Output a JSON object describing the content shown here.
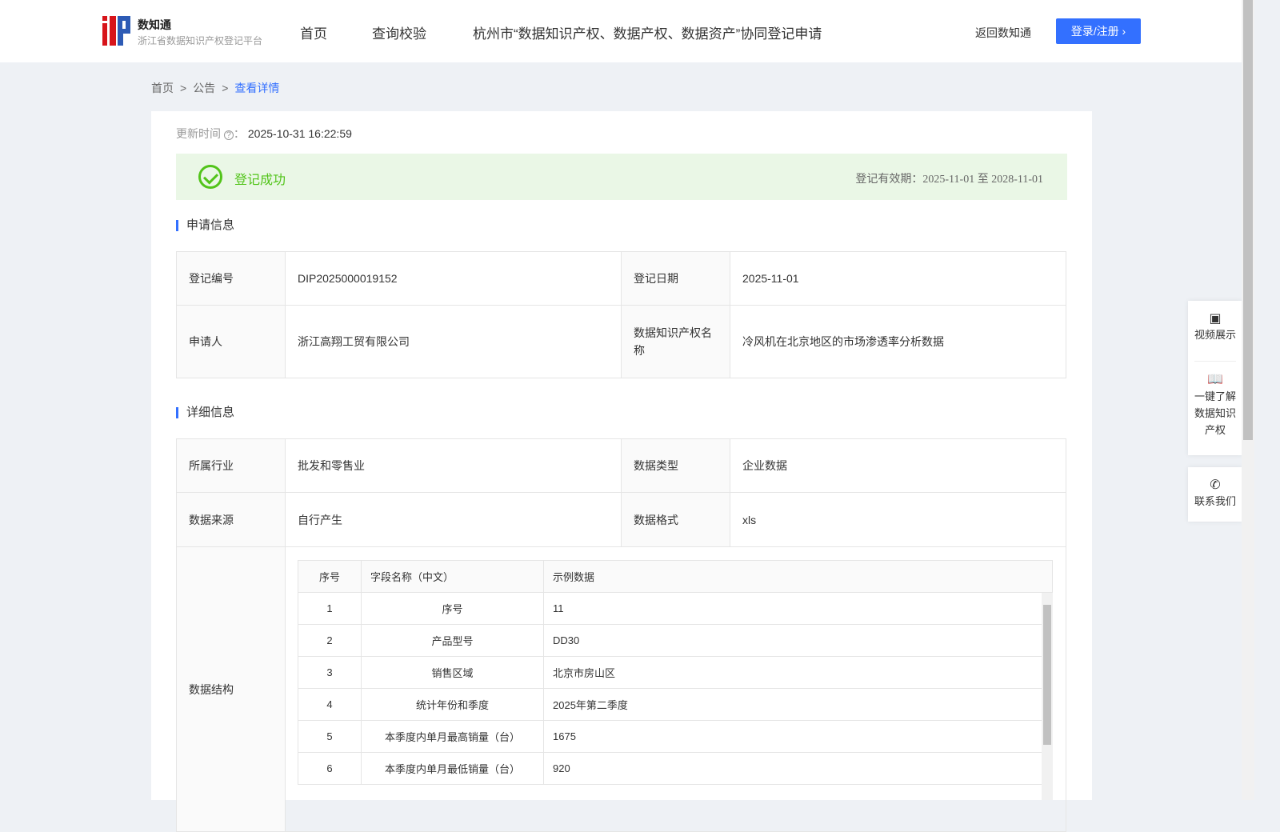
{
  "header": {
    "brand": "数知通",
    "subtitle": "浙江省数据知识产权登记平台",
    "nav": [
      "首页",
      "查询校验",
      "杭州市“数据知识产权、数据产权、数据资产”协同登记申请"
    ],
    "back": "返回数知通",
    "login": "登录/注册"
  },
  "breadcrumb": [
    "首页",
    "公告",
    "查看详情"
  ],
  "update": {
    "label": "更新时间",
    "value": "2025-10-31 16:22:59"
  },
  "status": {
    "text": "登记成功",
    "validity_label": "登记有效期：",
    "validity": "2025-11-01 至 2028-11-01"
  },
  "apply": {
    "title": "申请信息",
    "reg_no_label": "登记编号",
    "reg_no": "DIP2025000019152",
    "reg_date_label": "登记日期",
    "reg_date": "2025-11-01",
    "applicant_label": "申请人",
    "applicant": "浙江高翔工贸有限公司",
    "name_label": "数据知识产权名称",
    "name": "冷风机在北京地区的市场渗透率分析数据"
  },
  "detail": {
    "title": "详细信息",
    "industry_label": "所属行业",
    "industry": "批发和零售业",
    "type_label": "数据类型",
    "type": "企业数据",
    "source_label": "数据来源",
    "source": "自行产生",
    "format_label": "数据格式",
    "format": "xls",
    "structure_label": "数据结构",
    "columns": [
      "序号",
      "字段名称（中文）",
      "示例数据"
    ],
    "rows": [
      [
        "1",
        "序号",
        "11"
      ],
      [
        "2",
        "产品型号",
        "DD30"
      ],
      [
        "3",
        "销售区域",
        "北京市房山区"
      ],
      [
        "4",
        "统计年份和季度",
        "2025年第二季度"
      ],
      [
        "5",
        "本季度内单月最高销量（台）",
        "1675"
      ],
      [
        "6",
        "本季度内单月最低销量（台）",
        "920"
      ]
    ]
  },
  "side": {
    "video": "视频展示",
    "learn": "一键了解数据知识产权",
    "contact": "联系我们"
  }
}
